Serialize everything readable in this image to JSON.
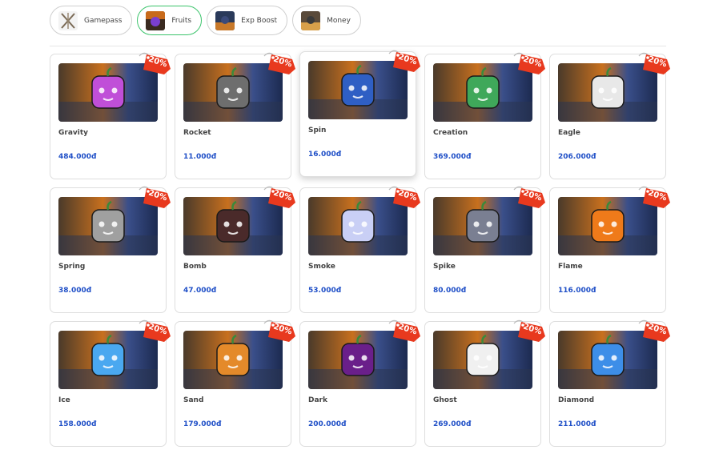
{
  "tabs": [
    {
      "label": "Gamepass",
      "icon": "crossed-swords-icon",
      "active": false
    },
    {
      "label": "Fruits",
      "icon": "fruit-icon",
      "active": true
    },
    {
      "label": "Exp Boost",
      "icon": "character-icon",
      "active": false
    },
    {
      "label": "Money",
      "icon": "character-icon",
      "active": false
    }
  ],
  "discount_label": "20%",
  "colors": {
    "price": "#1f4fc7",
    "tag": "#e8391e",
    "active_tab_border": "#3bc46b"
  },
  "products": [
    {
      "name": "Gravity",
      "price": "484.000đ",
      "icon": "gravity-fruit-icon",
      "color": "#c04fd8"
    },
    {
      "name": "Rocket",
      "price": "11.000đ",
      "icon": "rocket-fruit-icon",
      "color": "#6e6e6e"
    },
    {
      "name": "Spin",
      "price": "16.000đ",
      "icon": "spin-fruit-icon",
      "color": "#2f5fc4"
    },
    {
      "name": "Creation",
      "price": "369.000đ",
      "icon": "creation-fruit-icon",
      "color": "#3fa85a"
    },
    {
      "name": "Eagle",
      "price": "206.000đ",
      "icon": "eagle-fruit-icon",
      "color": "#e8e8e8"
    },
    {
      "name": "Spring",
      "price": "38.000đ",
      "icon": "spring-fruit-icon",
      "color": "#a0a0a0"
    },
    {
      "name": "Bomb",
      "price": "47.000đ",
      "icon": "bomb-fruit-icon",
      "color": "#4a2a2a"
    },
    {
      "name": "Smoke",
      "price": "53.000đ",
      "icon": "smoke-fruit-icon",
      "color": "#c9cff5"
    },
    {
      "name": "Spike",
      "price": "80.000đ",
      "icon": "spike-fruit-icon",
      "color": "#7a7f92"
    },
    {
      "name": "Flame",
      "price": "116.000đ",
      "icon": "flame-fruit-icon",
      "color": "#ef7a1a"
    },
    {
      "name": "Ice",
      "price": "158.000đ",
      "icon": "ice-fruit-icon",
      "color": "#4aa8f0"
    },
    {
      "name": "Sand",
      "price": "179.000đ",
      "icon": "sand-fruit-icon",
      "color": "#e48a2a"
    },
    {
      "name": "Dark",
      "price": "200.000đ",
      "icon": "dark-fruit-icon",
      "color": "#6a1f8a"
    },
    {
      "name": "Ghost",
      "price": "269.000đ",
      "icon": "ghost-fruit-icon",
      "color": "#f0f0f0"
    },
    {
      "name": "Diamond",
      "price": "211.000đ",
      "icon": "diamond-fruit-icon",
      "color": "#3d8ee8"
    }
  ]
}
